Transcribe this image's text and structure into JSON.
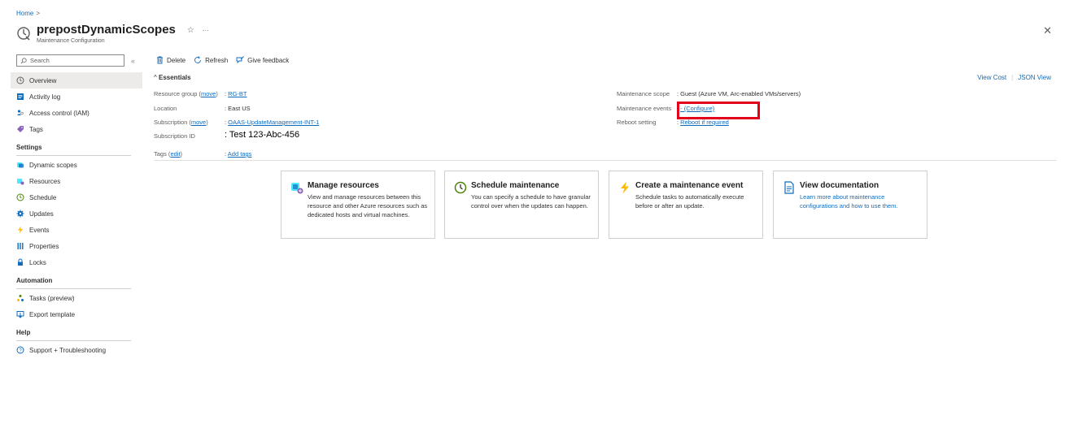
{
  "breadcrumb": {
    "home": "Home",
    "sep": ">"
  },
  "header": {
    "title": "prepostDynamicScopes",
    "subtitle": "Maintenance Configuration",
    "star": "☆",
    "more": "···",
    "close": "✕"
  },
  "sidebar": {
    "search_placeholder": "Search",
    "collapse": "«",
    "items": [
      {
        "label": "Overview",
        "icon": "maintenance-icon"
      },
      {
        "label": "Activity log",
        "icon": "activity-log-icon"
      },
      {
        "label": "Access control (IAM)",
        "icon": "iam-icon"
      },
      {
        "label": "Tags",
        "icon": "tag-icon"
      }
    ],
    "sections": [
      {
        "title": "Settings",
        "items": [
          {
            "label": "Dynamic scopes",
            "icon": "dynamic-scopes-icon"
          },
          {
            "label": "Resources",
            "icon": "resources-icon"
          },
          {
            "label": "Schedule",
            "icon": "clock-icon"
          },
          {
            "label": "Updates",
            "icon": "gear-icon"
          },
          {
            "label": "Events",
            "icon": "lightning-icon"
          },
          {
            "label": "Properties",
            "icon": "properties-icon"
          },
          {
            "label": "Locks",
            "icon": "lock-icon"
          }
        ]
      },
      {
        "title": "Automation",
        "items": [
          {
            "label": "Tasks (preview)",
            "icon": "tasks-icon"
          },
          {
            "label": "Export template",
            "icon": "export-icon"
          }
        ]
      },
      {
        "title": "Help",
        "items": [
          {
            "label": "Support + Troubleshooting",
            "icon": "support-icon"
          }
        ]
      }
    ]
  },
  "toolbar": {
    "delete": "Delete",
    "refresh": "Refresh",
    "feedback": "Give feedback"
  },
  "essentials": {
    "heading": "Essentials",
    "view_cost": "View Cost",
    "json_view": "JSON View",
    "divider": "|",
    "resource_group_label": "Resource group",
    "resource_group_move": "move",
    "resource_group_value": "RG-BT",
    "location_label": "Location",
    "location_value": "East US",
    "subscription_label": "Subscription",
    "subscription_move": "move",
    "subscription_value": "OAAS-UpdateManagement-INT-1",
    "subscription_id_label": "Subscription ID",
    "subscription_id_value": "Test 123-Abc-456",
    "tags_label": "Tags",
    "tags_edit": "edit",
    "tags_value": "Add tags",
    "scope_label": "Maintenance scope",
    "scope_value": "Guest (Azure VM, Arc-enabled VMs/servers)",
    "events_label": "Maintenance events",
    "events_value": "- (Configure)",
    "reboot_label": "Reboot setting",
    "reboot_value": "Reboot if required"
  },
  "cards": [
    {
      "title": "Manage resources",
      "desc": "View and manage resources between this resource and other Azure resources such as dedicated hosts and virtual machines.",
      "icon": "resources-icon"
    },
    {
      "title": "Schedule maintenance",
      "desc": "You can specify a schedule to have granular control over when the updates can happen.",
      "icon": "clock-icon"
    },
    {
      "title": "Create a maintenance event",
      "desc": "Schedule tasks to automatically execute before or after an update.",
      "icon": "lightning-icon"
    },
    {
      "title": "View documentation",
      "desc": "Learn more about maintenance configurations and how to use them.",
      "icon": "document-icon"
    }
  ],
  "colors": {
    "accent": "#0f6cbd",
    "highlight": "#e3001b",
    "active_bg": "#edebe9"
  }
}
